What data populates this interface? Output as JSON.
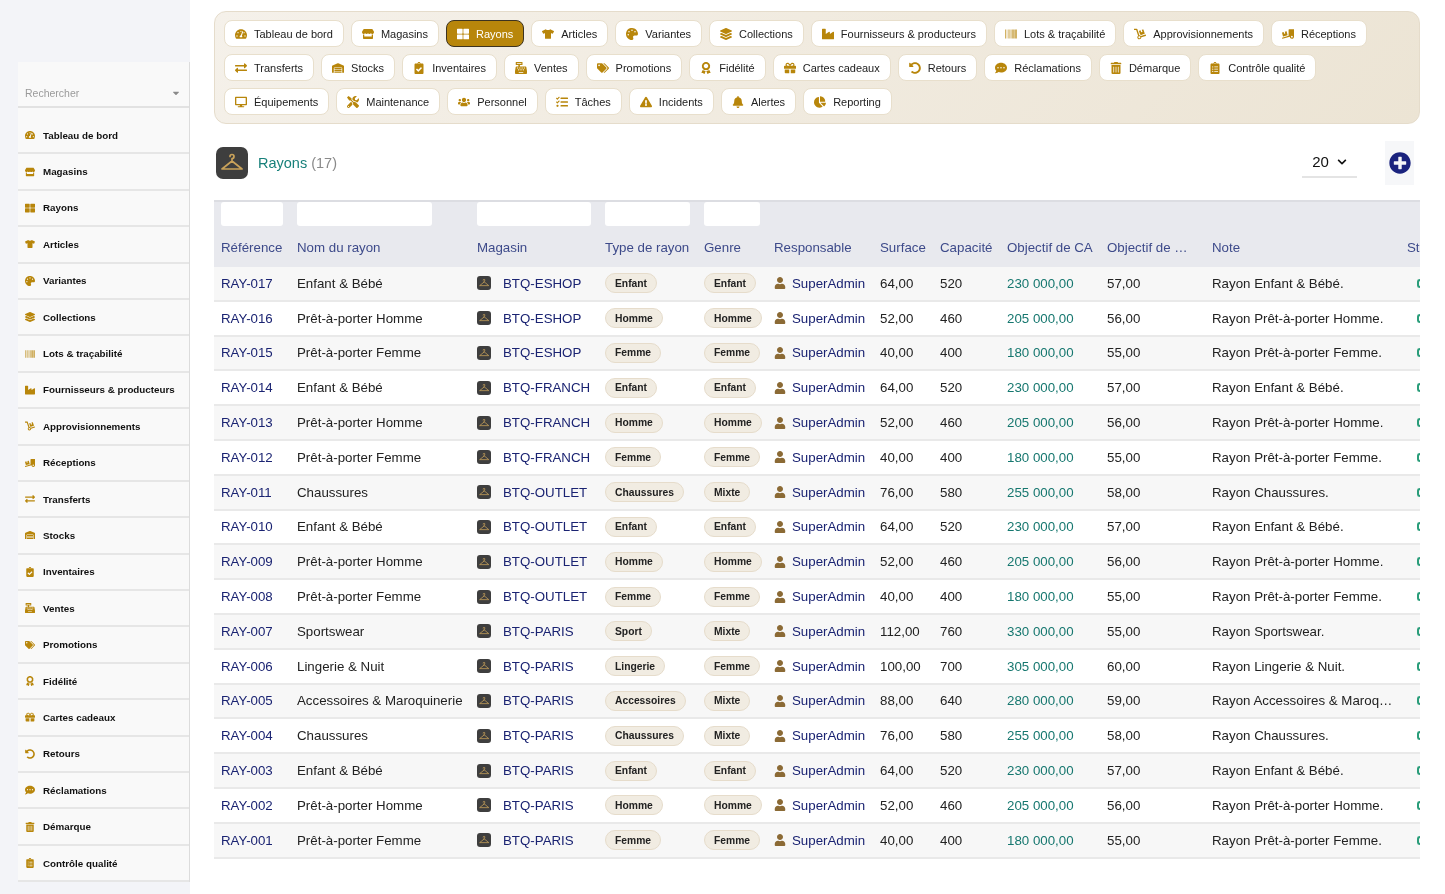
{
  "sidebar": {
    "search": {
      "placeholder": "Rechercher"
    },
    "items": [
      {
        "label": "Tableau de bord",
        "selected": false
      },
      {
        "label": "Magasins",
        "selected": false
      },
      {
        "label": "Rayons",
        "selected": false
      },
      {
        "label": "Articles",
        "selected": false
      },
      {
        "label": "Variantes",
        "selected": false
      },
      {
        "label": "Collections",
        "selected": false
      },
      {
        "label": "Lots & traçabilité",
        "selected": false
      },
      {
        "label": "Fournisseurs & producteurs",
        "selected": false
      },
      {
        "label": "Approvisionnements",
        "selected": false
      },
      {
        "label": "Réceptions",
        "selected": false
      },
      {
        "label": "Transferts",
        "selected": false
      },
      {
        "label": "Stocks",
        "selected": false
      },
      {
        "label": "Inventaires",
        "selected": false
      },
      {
        "label": "Ventes",
        "selected": false
      },
      {
        "label": "Promotions",
        "selected": false
      },
      {
        "label": "Fidélité",
        "selected": false
      },
      {
        "label": "Cartes cadeaux",
        "selected": false
      },
      {
        "label": "Retours",
        "selected": false
      },
      {
        "label": "Réclamations",
        "selected": false
      },
      {
        "label": "Démarque",
        "selected": false
      },
      {
        "label": "Contrôle qualité",
        "selected": false
      }
    ]
  },
  "tabs": [
    {
      "label": "Tableau de bord",
      "selected": false
    },
    {
      "label": "Magasins",
      "selected": false
    },
    {
      "label": "Rayons",
      "selected": true
    },
    {
      "label": "Articles",
      "selected": false
    },
    {
      "label": "Variantes",
      "selected": false
    },
    {
      "label": "Collections",
      "selected": false
    },
    {
      "label": "Fournisseurs & producteurs",
      "selected": false
    },
    {
      "label": "Lots & traçabilité",
      "selected": false
    },
    {
      "label": "Approvisionnements",
      "selected": false
    },
    {
      "label": "Réceptions",
      "selected": false
    },
    {
      "label": "Transferts",
      "selected": false
    },
    {
      "label": "Stocks",
      "selected": false
    },
    {
      "label": "Inventaires",
      "selected": false
    },
    {
      "label": "Ventes",
      "selected": false
    },
    {
      "label": "Promotions",
      "selected": false
    },
    {
      "label": "Fidélité",
      "selected": false
    },
    {
      "label": "Cartes cadeaux",
      "selected": false
    },
    {
      "label": "Retours",
      "selected": false
    },
    {
      "label": "Réclamations",
      "selected": false
    },
    {
      "label": "Démarque",
      "selected": false
    },
    {
      "label": "Contrôle qualité",
      "selected": false
    },
    {
      "label": "Équipements",
      "selected": false
    },
    {
      "label": "Maintenance",
      "selected": false
    },
    {
      "label": "Personnel",
      "selected": false
    },
    {
      "label": "Tâches",
      "selected": false
    },
    {
      "label": "Incidents",
      "selected": false
    },
    {
      "label": "Alertes",
      "selected": false
    },
    {
      "label": "Reporting",
      "selected": false
    }
  ],
  "header": {
    "title": "Rayons",
    "count": "(17)",
    "page_size": "20"
  },
  "table": {
    "columns": [
      {
        "label": "Référence",
        "filter": true
      },
      {
        "label": "Nom du rayon",
        "filter": true
      },
      {
        "label": "Magasin",
        "filter": true
      },
      {
        "label": "Type de rayon",
        "filter": true
      },
      {
        "label": "Genre",
        "filter": true
      },
      {
        "label": "Responsable",
        "filter": false
      },
      {
        "label": "Surface",
        "filter": false
      },
      {
        "label": "Capacité",
        "filter": false
      },
      {
        "label": "Objectif de CA",
        "filter": false
      },
      {
        "label": "Objectif de …",
        "filter": false
      },
      {
        "label": "Note",
        "filter": false
      },
      {
        "label": "St",
        "filter": false
      }
    ],
    "rows": [
      {
        "reference": "RAY-017",
        "name": "Enfant & Bébé",
        "store": "BTQ-ESHOP",
        "type": "Enfant",
        "genre": "Enfant",
        "manager": "SuperAdmin",
        "surface": "64,00",
        "capacity": "520",
        "revenue_target": "230 000,00",
        "column_10": "57,00",
        "note": "Rayon Enfant & Bébé."
      },
      {
        "reference": "RAY-016",
        "name": "Prêt-à-porter Homme",
        "store": "BTQ-ESHOP",
        "type": "Homme",
        "genre": "Homme",
        "manager": "SuperAdmin",
        "surface": "52,00",
        "capacity": "460",
        "revenue_target": "205 000,00",
        "column_10": "56,00",
        "note": "Rayon Prêt-à-porter Homme."
      },
      {
        "reference": "RAY-015",
        "name": "Prêt-à-porter Femme",
        "store": "BTQ-ESHOP",
        "type": "Femme",
        "genre": "Femme",
        "manager": "SuperAdmin",
        "surface": "40,00",
        "capacity": "400",
        "revenue_target": "180 000,00",
        "column_10": "55,00",
        "note": "Rayon Prêt-à-porter Femme."
      },
      {
        "reference": "RAY-014",
        "name": "Enfant & Bébé",
        "store": "BTQ-FRANCH",
        "type": "Enfant",
        "genre": "Enfant",
        "manager": "SuperAdmin",
        "surface": "64,00",
        "capacity": "520",
        "revenue_target": "230 000,00",
        "column_10": "57,00",
        "note": "Rayon Enfant & Bébé."
      },
      {
        "reference": "RAY-013",
        "name": "Prêt-à-porter Homme",
        "store": "BTQ-FRANCH",
        "type": "Homme",
        "genre": "Homme",
        "manager": "SuperAdmin",
        "surface": "52,00",
        "capacity": "460",
        "revenue_target": "205 000,00",
        "column_10": "56,00",
        "note": "Rayon Prêt-à-porter Homme."
      },
      {
        "reference": "RAY-012",
        "name": "Prêt-à-porter Femme",
        "store": "BTQ-FRANCH",
        "type": "Femme",
        "genre": "Femme",
        "manager": "SuperAdmin",
        "surface": "40,00",
        "capacity": "400",
        "revenue_target": "180 000,00",
        "column_10": "55,00",
        "note": "Rayon Prêt-à-porter Femme."
      },
      {
        "reference": "RAY-011",
        "name": "Chaussures",
        "store": "BTQ-OUTLET",
        "type": "Chaussures",
        "genre": "Mixte",
        "manager": "SuperAdmin",
        "surface": "76,00",
        "capacity": "580",
        "revenue_target": "255 000,00",
        "column_10": "58,00",
        "note": "Rayon Chaussures."
      },
      {
        "reference": "RAY-010",
        "name": "Enfant & Bébé",
        "store": "BTQ-OUTLET",
        "type": "Enfant",
        "genre": "Enfant",
        "manager": "SuperAdmin",
        "surface": "64,00",
        "capacity": "520",
        "revenue_target": "230 000,00",
        "column_10": "57,00",
        "note": "Rayon Enfant & Bébé."
      },
      {
        "reference": "RAY-009",
        "name": "Prêt-à-porter Homme",
        "store": "BTQ-OUTLET",
        "type": "Homme",
        "genre": "Homme",
        "manager": "SuperAdmin",
        "surface": "52,00",
        "capacity": "460",
        "revenue_target": "205 000,00",
        "column_10": "56,00",
        "note": "Rayon Prêt-à-porter Homme."
      },
      {
        "reference": "RAY-008",
        "name": "Prêt-à-porter Femme",
        "store": "BTQ-OUTLET",
        "type": "Femme",
        "genre": "Femme",
        "manager": "SuperAdmin",
        "surface": "40,00",
        "capacity": "400",
        "revenue_target": "180 000,00",
        "column_10": "55,00",
        "note": "Rayon Prêt-à-porter Femme."
      },
      {
        "reference": "RAY-007",
        "name": "Sportswear",
        "store": "BTQ-PARIS",
        "type": "Sport",
        "genre": "Mixte",
        "manager": "SuperAdmin",
        "surface": "112,00",
        "capacity": "760",
        "revenue_target": "330 000,00",
        "column_10": "55,00",
        "note": "Rayon Sportswear."
      },
      {
        "reference": "RAY-006",
        "name": "Lingerie & Nuit",
        "store": "BTQ-PARIS",
        "type": "Lingerie",
        "genre": "Femme",
        "manager": "SuperAdmin",
        "surface": "100,00",
        "capacity": "700",
        "revenue_target": "305 000,00",
        "column_10": "60,00",
        "note": "Rayon Lingerie & Nuit."
      },
      {
        "reference": "RAY-005",
        "name": "Accessoires & Maroquinerie",
        "store": "BTQ-PARIS",
        "type": "Accessoires",
        "genre": "Mixte",
        "manager": "SuperAdmin",
        "surface": "88,00",
        "capacity": "640",
        "revenue_target": "280 000,00",
        "column_10": "59,00",
        "note": "Rayon Accessoires & Maroq…"
      },
      {
        "reference": "RAY-004",
        "name": "Chaussures",
        "store": "BTQ-PARIS",
        "type": "Chaussures",
        "genre": "Mixte",
        "manager": "SuperAdmin",
        "surface": "76,00",
        "capacity": "580",
        "revenue_target": "255 000,00",
        "column_10": "58,00",
        "note": "Rayon Chaussures."
      },
      {
        "reference": "RAY-003",
        "name": "Enfant & Bébé",
        "store": "BTQ-PARIS",
        "type": "Enfant",
        "genre": "Enfant",
        "manager": "SuperAdmin",
        "surface": "64,00",
        "capacity": "520",
        "revenue_target": "230 000,00",
        "column_10": "57,00",
        "note": "Rayon Enfant & Bébé."
      },
      {
        "reference": "RAY-002",
        "name": "Prêt-à-porter Homme",
        "store": "BTQ-PARIS",
        "type": "Homme",
        "genre": "Homme",
        "manager": "SuperAdmin",
        "surface": "52,00",
        "capacity": "460",
        "revenue_target": "205 000,00",
        "column_10": "56,00",
        "note": "Rayon Prêt-à-porter Homme."
      },
      {
        "reference": "RAY-001",
        "name": "Prêt-à-porter Femme",
        "store": "BTQ-PARIS",
        "type": "Femme",
        "genre": "Femme",
        "manager": "SuperAdmin",
        "surface": "40,00",
        "capacity": "400",
        "revenue_target": "180 000,00",
        "column_10": "55,00",
        "note": "Rayon Prêt-à-porter Femme."
      }
    ]
  }
}
